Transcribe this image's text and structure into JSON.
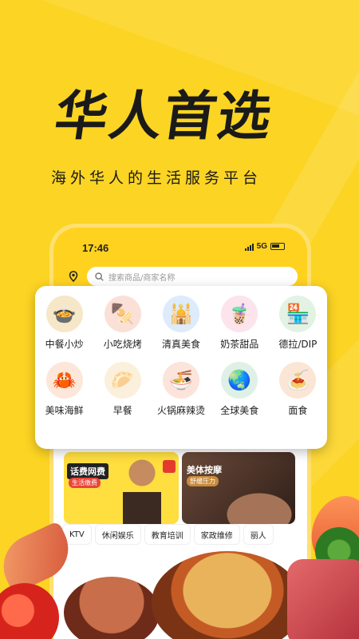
{
  "headline": "华人首选",
  "subline": "海外华人的生活服务平台",
  "status_bar": {
    "time": "17:46",
    "network": "5G"
  },
  "search": {
    "placeholder": "搜索商品/商家名称"
  },
  "categories": [
    {
      "label": "中餐小炒",
      "icon": "chinese-food-icon",
      "color": "#F6E7C8",
      "glyph": "🍲"
    },
    {
      "label": "小吃烧烤",
      "icon": "bbq-icon",
      "color": "#FBE0D8",
      "glyph": "🍢"
    },
    {
      "label": "清真美食",
      "icon": "halal-food-icon",
      "color": "#DDEBFB",
      "glyph": "🕌"
    },
    {
      "label": "奶茶甜品",
      "icon": "milk-tea-icon",
      "color": "#FCE3EC",
      "glyph": "🧋"
    },
    {
      "label": "德拉/DIP",
      "icon": "store-icon",
      "color": "#E3F3E3",
      "glyph": "🏪"
    },
    {
      "label": "美味海鲜",
      "icon": "seafood-icon",
      "color": "#FDE6DA",
      "glyph": "🦀"
    },
    {
      "label": "早餐",
      "icon": "breakfast-icon",
      "color": "#FBF0DC",
      "glyph": "🥟"
    },
    {
      "label": "火锅麻辣烫",
      "icon": "hotpot-icon",
      "color": "#FCE4DA",
      "glyph": "🍜"
    },
    {
      "label": "全球美食",
      "icon": "global-food-icon",
      "color": "#DFF1E6",
      "glyph": "🌏"
    },
    {
      "label": "面食",
      "icon": "noodles-icon",
      "color": "#FBE6D6",
      "glyph": "🍝"
    }
  ],
  "promos": {
    "left": {
      "title": "话费网费",
      "tag": "生活缴费"
    },
    "right": {
      "title": "美体按摩",
      "tag": "舒缓压力"
    }
  },
  "services": [
    "KTV",
    "休闲娱乐",
    "教育培训",
    "家政维修",
    "丽人"
  ],
  "colors": {
    "background": "#FCD423",
    "accent": "#FFD21F",
    "text": "#1A1A1A"
  }
}
